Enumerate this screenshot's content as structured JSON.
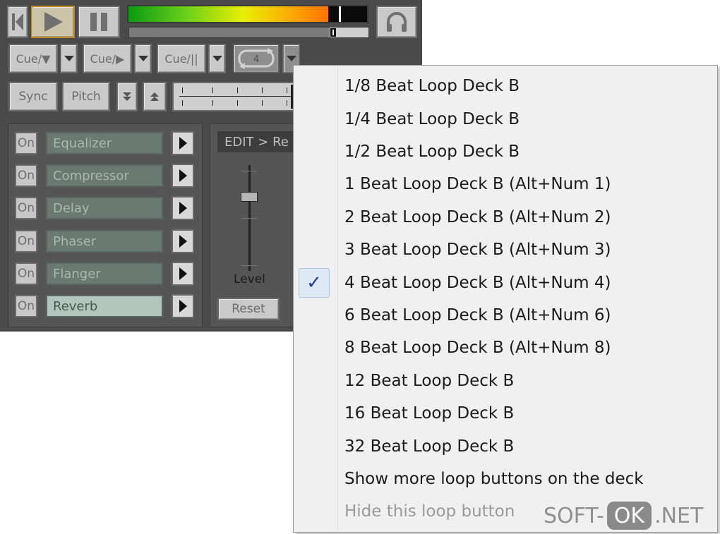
{
  "deck": {
    "cue_buttons": [
      "Cue/▼",
      "Cue/▶",
      "Cue/||"
    ],
    "loop_badge": "4",
    "sync_label": "Sync",
    "pitch_label": "Pitch",
    "effects": [
      {
        "on_label": "On",
        "name": "Equalizer"
      },
      {
        "on_label": "On",
        "name": "Compressor"
      },
      {
        "on_label": "On",
        "name": "Delay"
      },
      {
        "on_label": "On",
        "name": "Phaser"
      },
      {
        "on_label": "On",
        "name": "Flanger"
      },
      {
        "on_label": "On",
        "name": "Reverb"
      }
    ],
    "selected_effect": "Reverb",
    "edit_header": "EDIT > Re",
    "level_label": "Level",
    "reset_label": "Reset",
    "colors": {
      "panel": "#4a4a4a",
      "vu_low": "#0a9a10",
      "vu_mid": "#e9ef00",
      "vu_high": "#ff3c00"
    }
  },
  "menu": {
    "items": [
      {
        "label": "1/8 Beat Loop Deck B",
        "checked": false,
        "disabled": false
      },
      {
        "label": "1/4 Beat Loop Deck B",
        "checked": false,
        "disabled": false
      },
      {
        "label": "1/2 Beat Loop Deck B",
        "checked": false,
        "disabled": false
      },
      {
        "label": "1 Beat Loop Deck B (Alt+Num 1)",
        "checked": false,
        "disabled": false
      },
      {
        "label": "2 Beat Loop Deck B (Alt+Num 2)",
        "checked": false,
        "disabled": false
      },
      {
        "label": "3 Beat Loop Deck B (Alt+Num 3)",
        "checked": false,
        "disabled": false
      },
      {
        "label": "4 Beat Loop Deck B (Alt+Num 4)",
        "checked": true,
        "disabled": false
      },
      {
        "label": "6 Beat Loop Deck B (Alt+Num 6)",
        "checked": false,
        "disabled": false
      },
      {
        "label": "8 Beat Loop Deck B (Alt+Num 8)",
        "checked": false,
        "disabled": false
      },
      {
        "label": "12 Beat Loop Deck B",
        "checked": false,
        "disabled": false
      },
      {
        "label": "16 Beat Loop Deck B",
        "checked": false,
        "disabled": false
      },
      {
        "label": "32 Beat Loop Deck B",
        "checked": false,
        "disabled": false
      },
      {
        "label": "Show more loop buttons on the deck",
        "checked": false,
        "disabled": false
      },
      {
        "label": "Hide this loop button",
        "checked": false,
        "disabled": true
      }
    ],
    "check_glyph": "✓"
  },
  "watermark": {
    "left": "SOFT-",
    "badge": "OK",
    "right": ".NET"
  }
}
